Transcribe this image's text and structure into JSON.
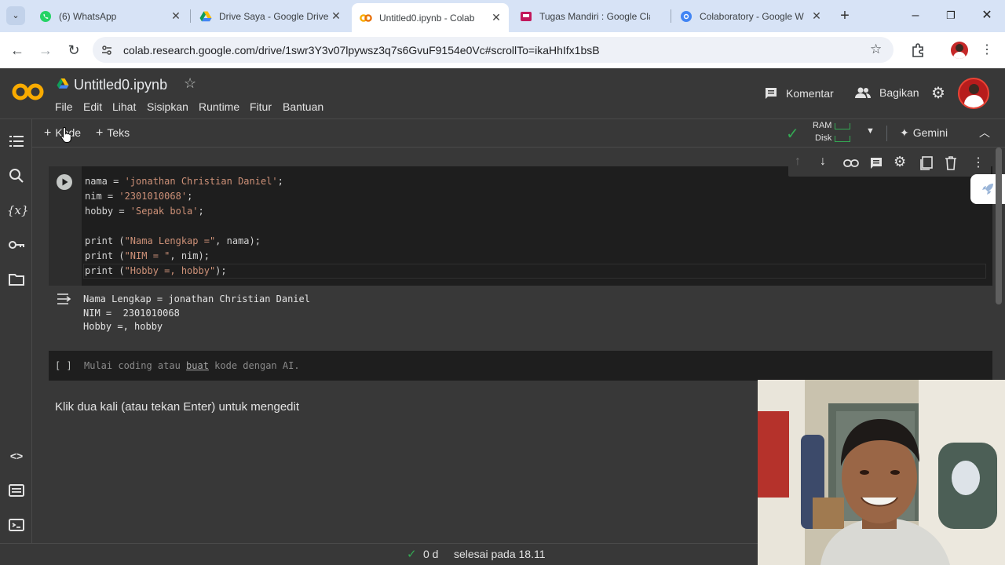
{
  "browser": {
    "tabs": [
      {
        "title": "(6) WhatsApp",
        "favicon": "whatsapp-icon",
        "active": false
      },
      {
        "title": "Drive Saya - Google Drive",
        "favicon": "google-drive-icon",
        "active": false
      },
      {
        "title": "Untitled0.ipynb - Colab",
        "favicon": "colab-icon",
        "active": true
      },
      {
        "title": "Tugas Mandiri : Google Classroom",
        "favicon": "google-classroom-icon",
        "active": false
      },
      {
        "title": "Colaboratory - Google W",
        "favicon": "google-workspace-icon",
        "active": false
      }
    ],
    "url": "colab.research.google.com/drive/1swr3Y3v07lpywsz3q7s6GvuF9154e0Vc#scrollTo=ikaHhIfx1bsB"
  },
  "colab": {
    "logo": "CO",
    "notebook_title": "Untitled0.ipynb",
    "menu": [
      "File",
      "Edit",
      "Lihat",
      "Sisipkan",
      "Runtime",
      "Fitur",
      "Bantuan"
    ],
    "comment_label": "Komentar",
    "share_label": "Bagikan",
    "add_code_label": "Kode",
    "add_text_label": "Teks",
    "ram_label": "RAM",
    "disk_label": "Disk",
    "gemini_label": "Gemini"
  },
  "cells": {
    "code_lines": [
      [
        {
          "t": "nama = ",
          "c": ""
        },
        {
          "t": "'jonathan Christian Daniel'",
          "c": "str"
        },
        {
          "t": ";",
          "c": ""
        }
      ],
      [
        {
          "t": "nim = ",
          "c": ""
        },
        {
          "t": "'2301010068'",
          "c": "str"
        },
        {
          "t": ";",
          "c": ""
        }
      ],
      [
        {
          "t": "hobby = ",
          "c": ""
        },
        {
          "t": "'Sepak bola'",
          "c": "str"
        },
        {
          "t": ";",
          "c": ""
        }
      ],
      [
        {
          "t": "",
          "c": ""
        }
      ],
      [
        {
          "t": "print (",
          "c": ""
        },
        {
          "t": "\"Nama Lengkap =\"",
          "c": "str"
        },
        {
          "t": ", nama);",
          "c": ""
        }
      ],
      [
        {
          "t": "print (",
          "c": ""
        },
        {
          "t": "\"NIM = \"",
          "c": "str"
        },
        {
          "t": ", nim);",
          "c": ""
        }
      ],
      [
        {
          "t": "print (",
          "c": ""
        },
        {
          "t": "\"Hobby =, hobby\"",
          "c": "str"
        },
        {
          "t": ");",
          "c": ""
        }
      ]
    ],
    "output_lines": [
      "Nama Lengkap = jonathan Christian Daniel",
      "NIM =  2301010068",
      "Hobby =, hobby"
    ],
    "empty_cell": {
      "brackets": "[ ]",
      "placeholder_prefix": "Mulai coding atau ",
      "placeholder_link": "buat",
      "placeholder_suffix": " kode dengan AI."
    },
    "markdown_hint": "Klik dua kali (atau tekan Enter) untuk mengedit"
  },
  "status": {
    "exec_time": "0 d",
    "completed": "selesai pada 18.11"
  },
  "colors": {
    "accent_orange": "#f9ab00",
    "check_green": "#34a853",
    "string_color": "#ce9178"
  }
}
